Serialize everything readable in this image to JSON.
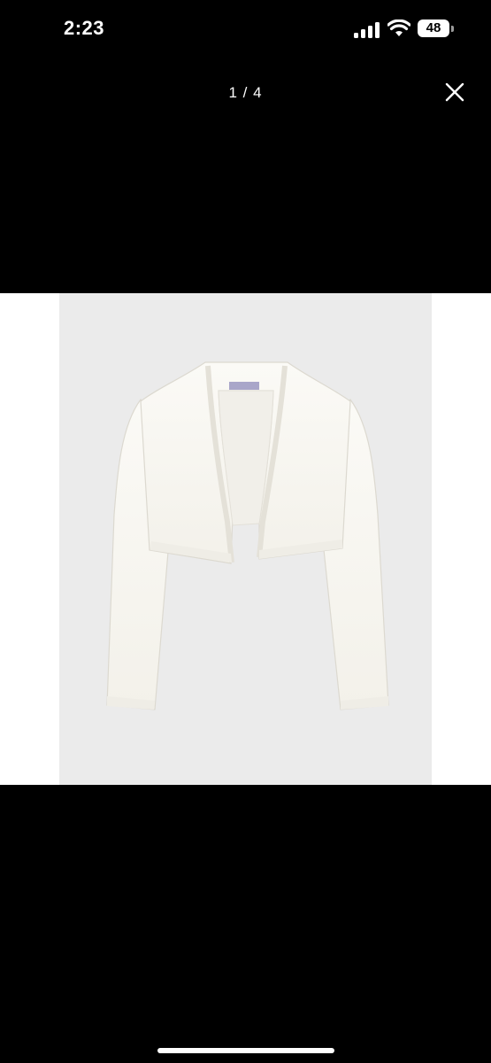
{
  "status_bar": {
    "time": "2:23",
    "battery_level": "48",
    "icons": [
      "cellular-signal-icon",
      "wifi-icon",
      "battery-icon"
    ]
  },
  "viewer": {
    "page_counter": "1 / 4",
    "close_icon": "close-icon"
  },
  "image": {
    "subject": "cardigan-photo",
    "background_color": "#ebebeb",
    "label_color": "#a9a6c9"
  },
  "colors": {
    "background": "#000000",
    "text": "#ffffff"
  }
}
